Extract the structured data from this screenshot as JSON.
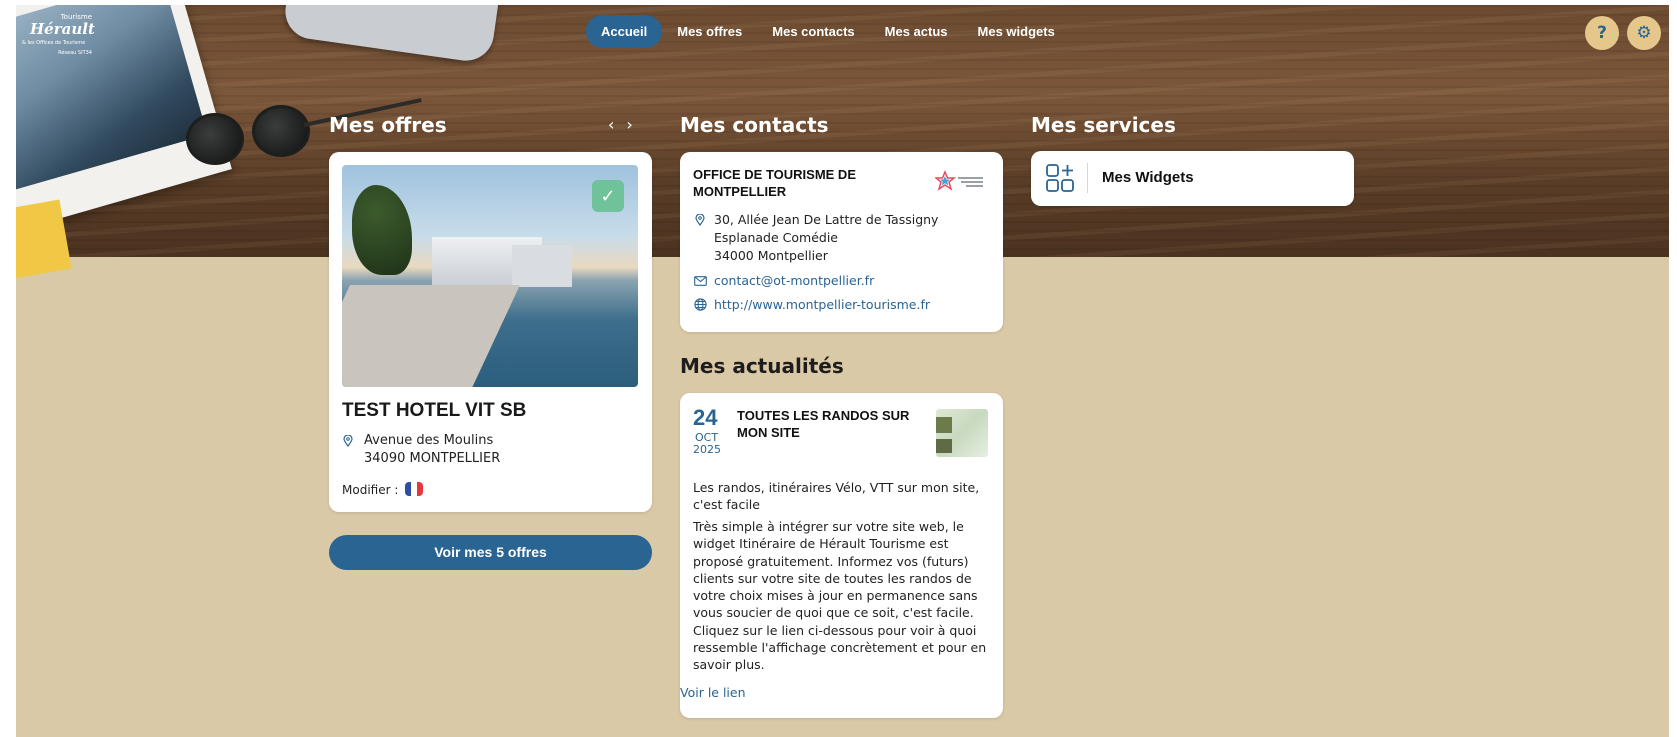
{
  "logo": {
    "small": "Tourisme",
    "big": "Hérault",
    "sub": "& les Offices de Tourisme",
    "sub2": "Réseau SIT34"
  },
  "nav": {
    "items": [
      "Accueil",
      "Mes offres",
      "Mes contacts",
      "Mes actus",
      "Mes widgets"
    ],
    "active": "Accueil"
  },
  "top_buttons": {
    "help": "?",
    "settings": "⚙"
  },
  "offres": {
    "title": "Mes offres",
    "prev": "‹",
    "next": "›",
    "offer": {
      "name": "TEST HOTEL VIT SB",
      "address_line1": "Avenue des Moulins",
      "address_line2": "34090 MONTPELLIER",
      "modify_label": "Modifier :",
      "status_icon": "check-icon"
    },
    "cta": "Voir mes 5 offres"
  },
  "contacts": {
    "title": "Mes contacts",
    "name": "OFFICE DE TOURISME DE MONTPELLIER",
    "address_line1": "30, Allée Jean De Lattre de Tassigny",
    "address_line2": "Esplanade Comédie",
    "address_line3": "34000 Montpellier",
    "email": "contact@ot-montpellier.fr",
    "website": "http://www.montpellier-tourisme.fr"
  },
  "services": {
    "title": "Mes services",
    "item_label": "Mes Widgets"
  },
  "actus": {
    "title": "Mes actualités",
    "day": "24",
    "month": "OCT",
    "year": "2025",
    "headline": "TOUTES LES RANDOS SUR MON SITE",
    "lead": "Les randos, itinéraires Vélo, VTT sur mon site, c'est facile",
    "body": "Très simple à intégrer sur votre site web, le widget Itinéraire de Hérault Tourisme est proposé gratuitement. Informez vos (futurs) clients sur votre site de toutes les randos de votre choix mises à jour en permanence sans vous soucier de quoi que ce soit, c'est facile. Cliquez sur le lien ci-dessous pour voir à quoi ressemble l'affichage concrètement et pour en savoir plus.",
    "link": "Voir le lien"
  },
  "colors": {
    "accent": "#2a6493",
    "background": "#dac9a7",
    "badge": "#e6c78b",
    "check": "#6fc29a"
  }
}
